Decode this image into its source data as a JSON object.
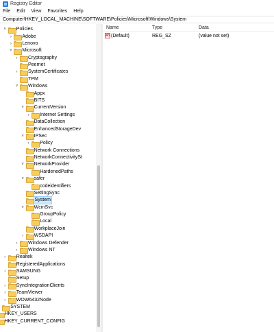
{
  "window": {
    "title": "Registry Editor"
  },
  "menu": [
    "File",
    "Edit",
    "View",
    "Favorites",
    "Help"
  ],
  "address": "Computer\\HKEY_LOCAL_MACHINE\\SOFTWARE\\Policies\\Microsoft\\Windows\\System",
  "tree": [
    {
      "label": "Policies",
      "expand": "open"
    },
    {
      "label": "Adobe",
      "expand": "closed"
    },
    {
      "label": "Lenovo",
      "expand": "closed"
    },
    {
      "label": "Microsoft",
      "expand": "open"
    },
    {
      "label": "Cryptography",
      "expand": "closed"
    },
    {
      "label": "Peernet",
      "expand": "none"
    },
    {
      "label": "SystemCertificates",
      "expand": "closed"
    },
    {
      "label": "TPM",
      "expand": "none"
    },
    {
      "label": "Windows",
      "expand": "open"
    },
    {
      "label": "Appx",
      "expand": "none"
    },
    {
      "label": "BITS",
      "expand": "none"
    },
    {
      "label": "CurrentVersion",
      "expand": "open"
    },
    {
      "label": "Internet Settings",
      "expand": "closed"
    },
    {
      "label": "DataCollection",
      "expand": "none"
    },
    {
      "label": "EnhancedStorageDev",
      "expand": "none"
    },
    {
      "label": "IPSec",
      "expand": "open"
    },
    {
      "label": "Policy",
      "expand": "closed"
    },
    {
      "label": "Network Connections",
      "expand": "none"
    },
    {
      "label": "NetworkConnectivitySt",
      "expand": "none"
    },
    {
      "label": "NetworkProvider",
      "expand": "open"
    },
    {
      "label": "HardenedPaths",
      "expand": "none"
    },
    {
      "label": "safer",
      "expand": "open"
    },
    {
      "label": "codeidentifiers",
      "expand": "none"
    },
    {
      "label": "SettingSync",
      "expand": "none"
    },
    {
      "label": "System",
      "expand": "none",
      "selected": true
    },
    {
      "label": "WcmSvc",
      "expand": "open"
    },
    {
      "label": "GroupPolicy",
      "expand": "none"
    },
    {
      "label": "Local",
      "expand": "none"
    },
    {
      "label": "WorkplaceJoin",
      "expand": "none"
    },
    {
      "label": "WSDAPI",
      "expand": "closed"
    },
    {
      "label": "Windows Defender",
      "expand": "closed"
    },
    {
      "label": "Windows NT",
      "expand": "closed"
    },
    {
      "label": "Realtek",
      "expand": "closed"
    },
    {
      "label": "RegisteredApplications",
      "expand": "none"
    },
    {
      "label": "SAMSUNG",
      "expand": "closed"
    },
    {
      "label": "Setup",
      "expand": "none"
    },
    {
      "label": "SyncIntegrationClients",
      "expand": "closed"
    },
    {
      "label": "TeamViewer",
      "expand": "closed"
    },
    {
      "label": "WOW6432Node",
      "expand": "closed"
    },
    {
      "label": "SYSTEM",
      "expand": "closed"
    },
    {
      "label": "HKEY_USERS",
      "expand": "closed"
    },
    {
      "label": "HKEY_CURRENT_CONFIG",
      "expand": "closed"
    }
  ],
  "list": {
    "columns": {
      "name": "Name",
      "type": "Type",
      "data": "Data"
    },
    "rows": [
      {
        "icon": "string-value-icon",
        "icon_text": "ab",
        "name": "(Default)",
        "type": "REG_SZ",
        "data": "(value not set)"
      }
    ]
  },
  "colors": {
    "selection": "#cce8ff",
    "folder": "#f7cd5b"
  }
}
